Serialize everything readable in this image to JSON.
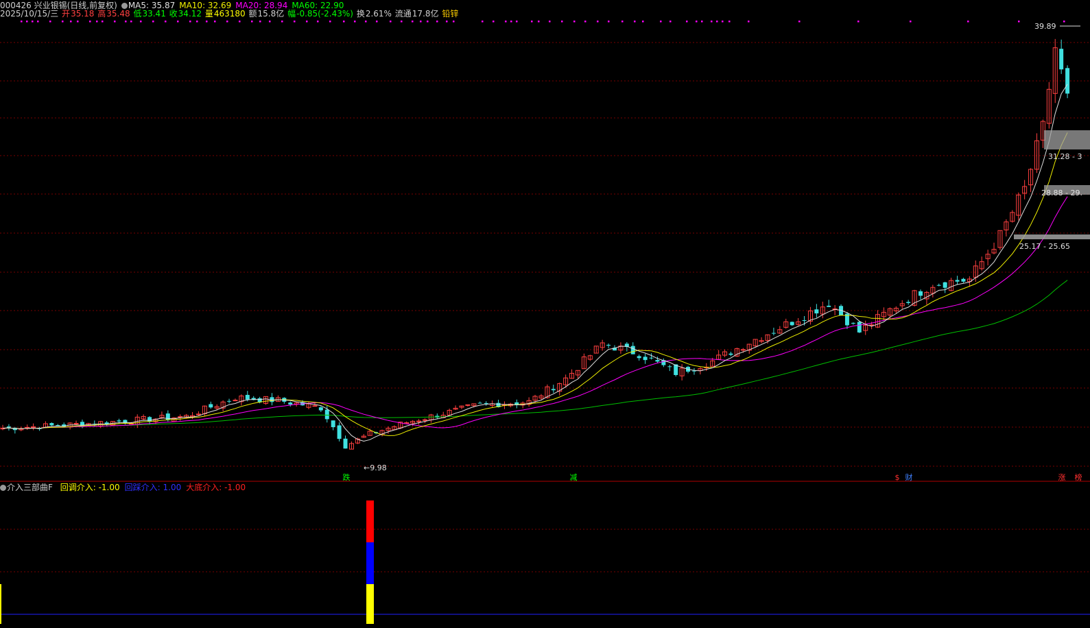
{
  "header": {
    "code_name": "000426 兴业银锡(日线,前复权)",
    "ma": [
      {
        "label": "MA5:",
        "value": "35.87",
        "color": "#e0e0e0"
      },
      {
        "label": "MA10:",
        "value": "32.69",
        "color": "#f0f000"
      },
      {
        "label": "MA20:",
        "value": "28.94",
        "color": "#ff00ff"
      },
      {
        "label": "MA60:",
        "value": "22.90",
        "color": "#00ff00"
      }
    ],
    "date": "2025/10/15/三",
    "open_label": "开",
    "open": "35.18",
    "high_label": "高",
    "high": "35.48",
    "low_label": "低",
    "low": "33.41",
    "close_label": "收",
    "close": "34.12",
    "volume_label": "量",
    "volume": "463180",
    "amount_label": "额",
    "amount": "15.8亿",
    "change_label": "幅",
    "change": "-0.85(-2.43%)",
    "turnover_label": "换",
    "turnover": "2.61%",
    "float_label": "流通",
    "float": "17.8亿",
    "tag": "铅锌"
  },
  "price_labels": {
    "high": "39.89",
    "low": "9.98",
    "zone1": "31.28 - 3",
    "zone2": "28.88 - 29.",
    "zone3": "25.17 - 25.65"
  },
  "markers": [
    {
      "text": "跌",
      "color": "#00ff00"
    },
    {
      "text": "减",
      "color": "#00ff00"
    },
    {
      "text": "$",
      "color": "#ff3030"
    },
    {
      "text": "财",
      "color": "#4080ff"
    },
    {
      "text": "涨",
      "color": "#ff3030"
    },
    {
      "text": "榜",
      "color": "#ff3030"
    }
  ],
  "indicator": {
    "name": "介入三部曲F",
    "items": [
      {
        "label": "回调介入: -1.00",
        "color": "#ffff00"
      },
      {
        "label": "回踩介入: 1.00",
        "color": "#3030ff"
      },
      {
        "label": "大底介入: -1.00",
        "color": "#ff2020"
      }
    ]
  },
  "colors": {
    "up": "#ff4040",
    "down": "#40e0e0",
    "grid": "#7a0000",
    "ma5": "#e0e0e0",
    "ma10": "#f0f000",
    "ma20": "#ff00ff",
    "ma60": "#00c000",
    "zone": "#a0a0a0"
  }
}
